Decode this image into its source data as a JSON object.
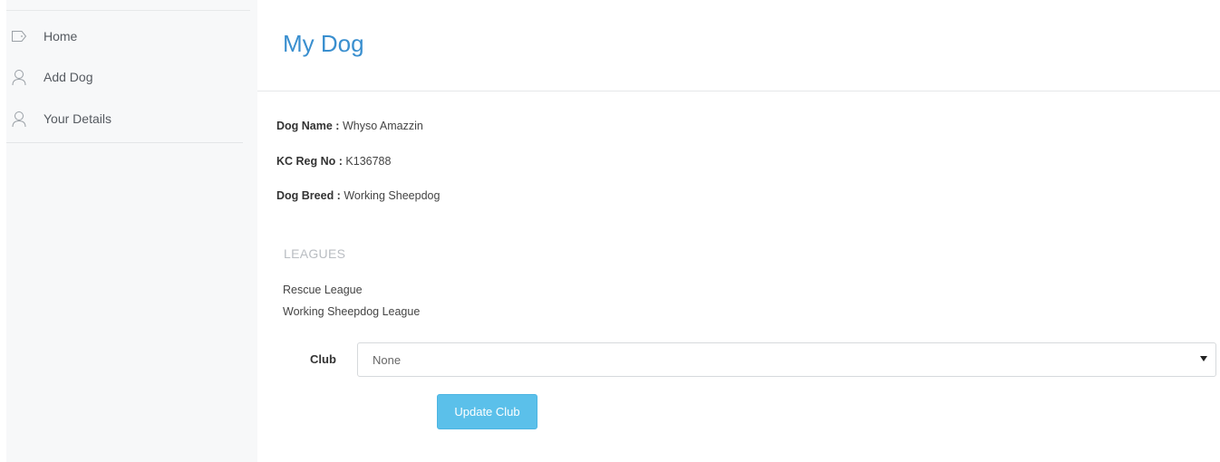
{
  "sidebar": {
    "items": [
      {
        "label": "Home",
        "icon": "tag-icon"
      },
      {
        "label": "Add Dog",
        "icon": "user-icon"
      },
      {
        "label": "Your Details",
        "icon": "user-icon"
      }
    ]
  },
  "main": {
    "title": "My Dog",
    "details": [
      {
        "label": "Dog Name :",
        "value": "Whyso Amazzin"
      },
      {
        "label": "KC Reg No :",
        "value": "K136788"
      },
      {
        "label": "Dog Breed :",
        "value": "Working Sheepdog"
      }
    ],
    "leagues": {
      "heading": "LEAGUES",
      "items": [
        "Rescue League",
        "Working Sheepdog League"
      ]
    },
    "club": {
      "label": "Club",
      "selected": "None",
      "button_label": "Update Club"
    }
  },
  "colors": {
    "accent": "#3a8fcf",
    "button": "#5bc0ea",
    "sidebar_bg": "#f7f8f9"
  }
}
